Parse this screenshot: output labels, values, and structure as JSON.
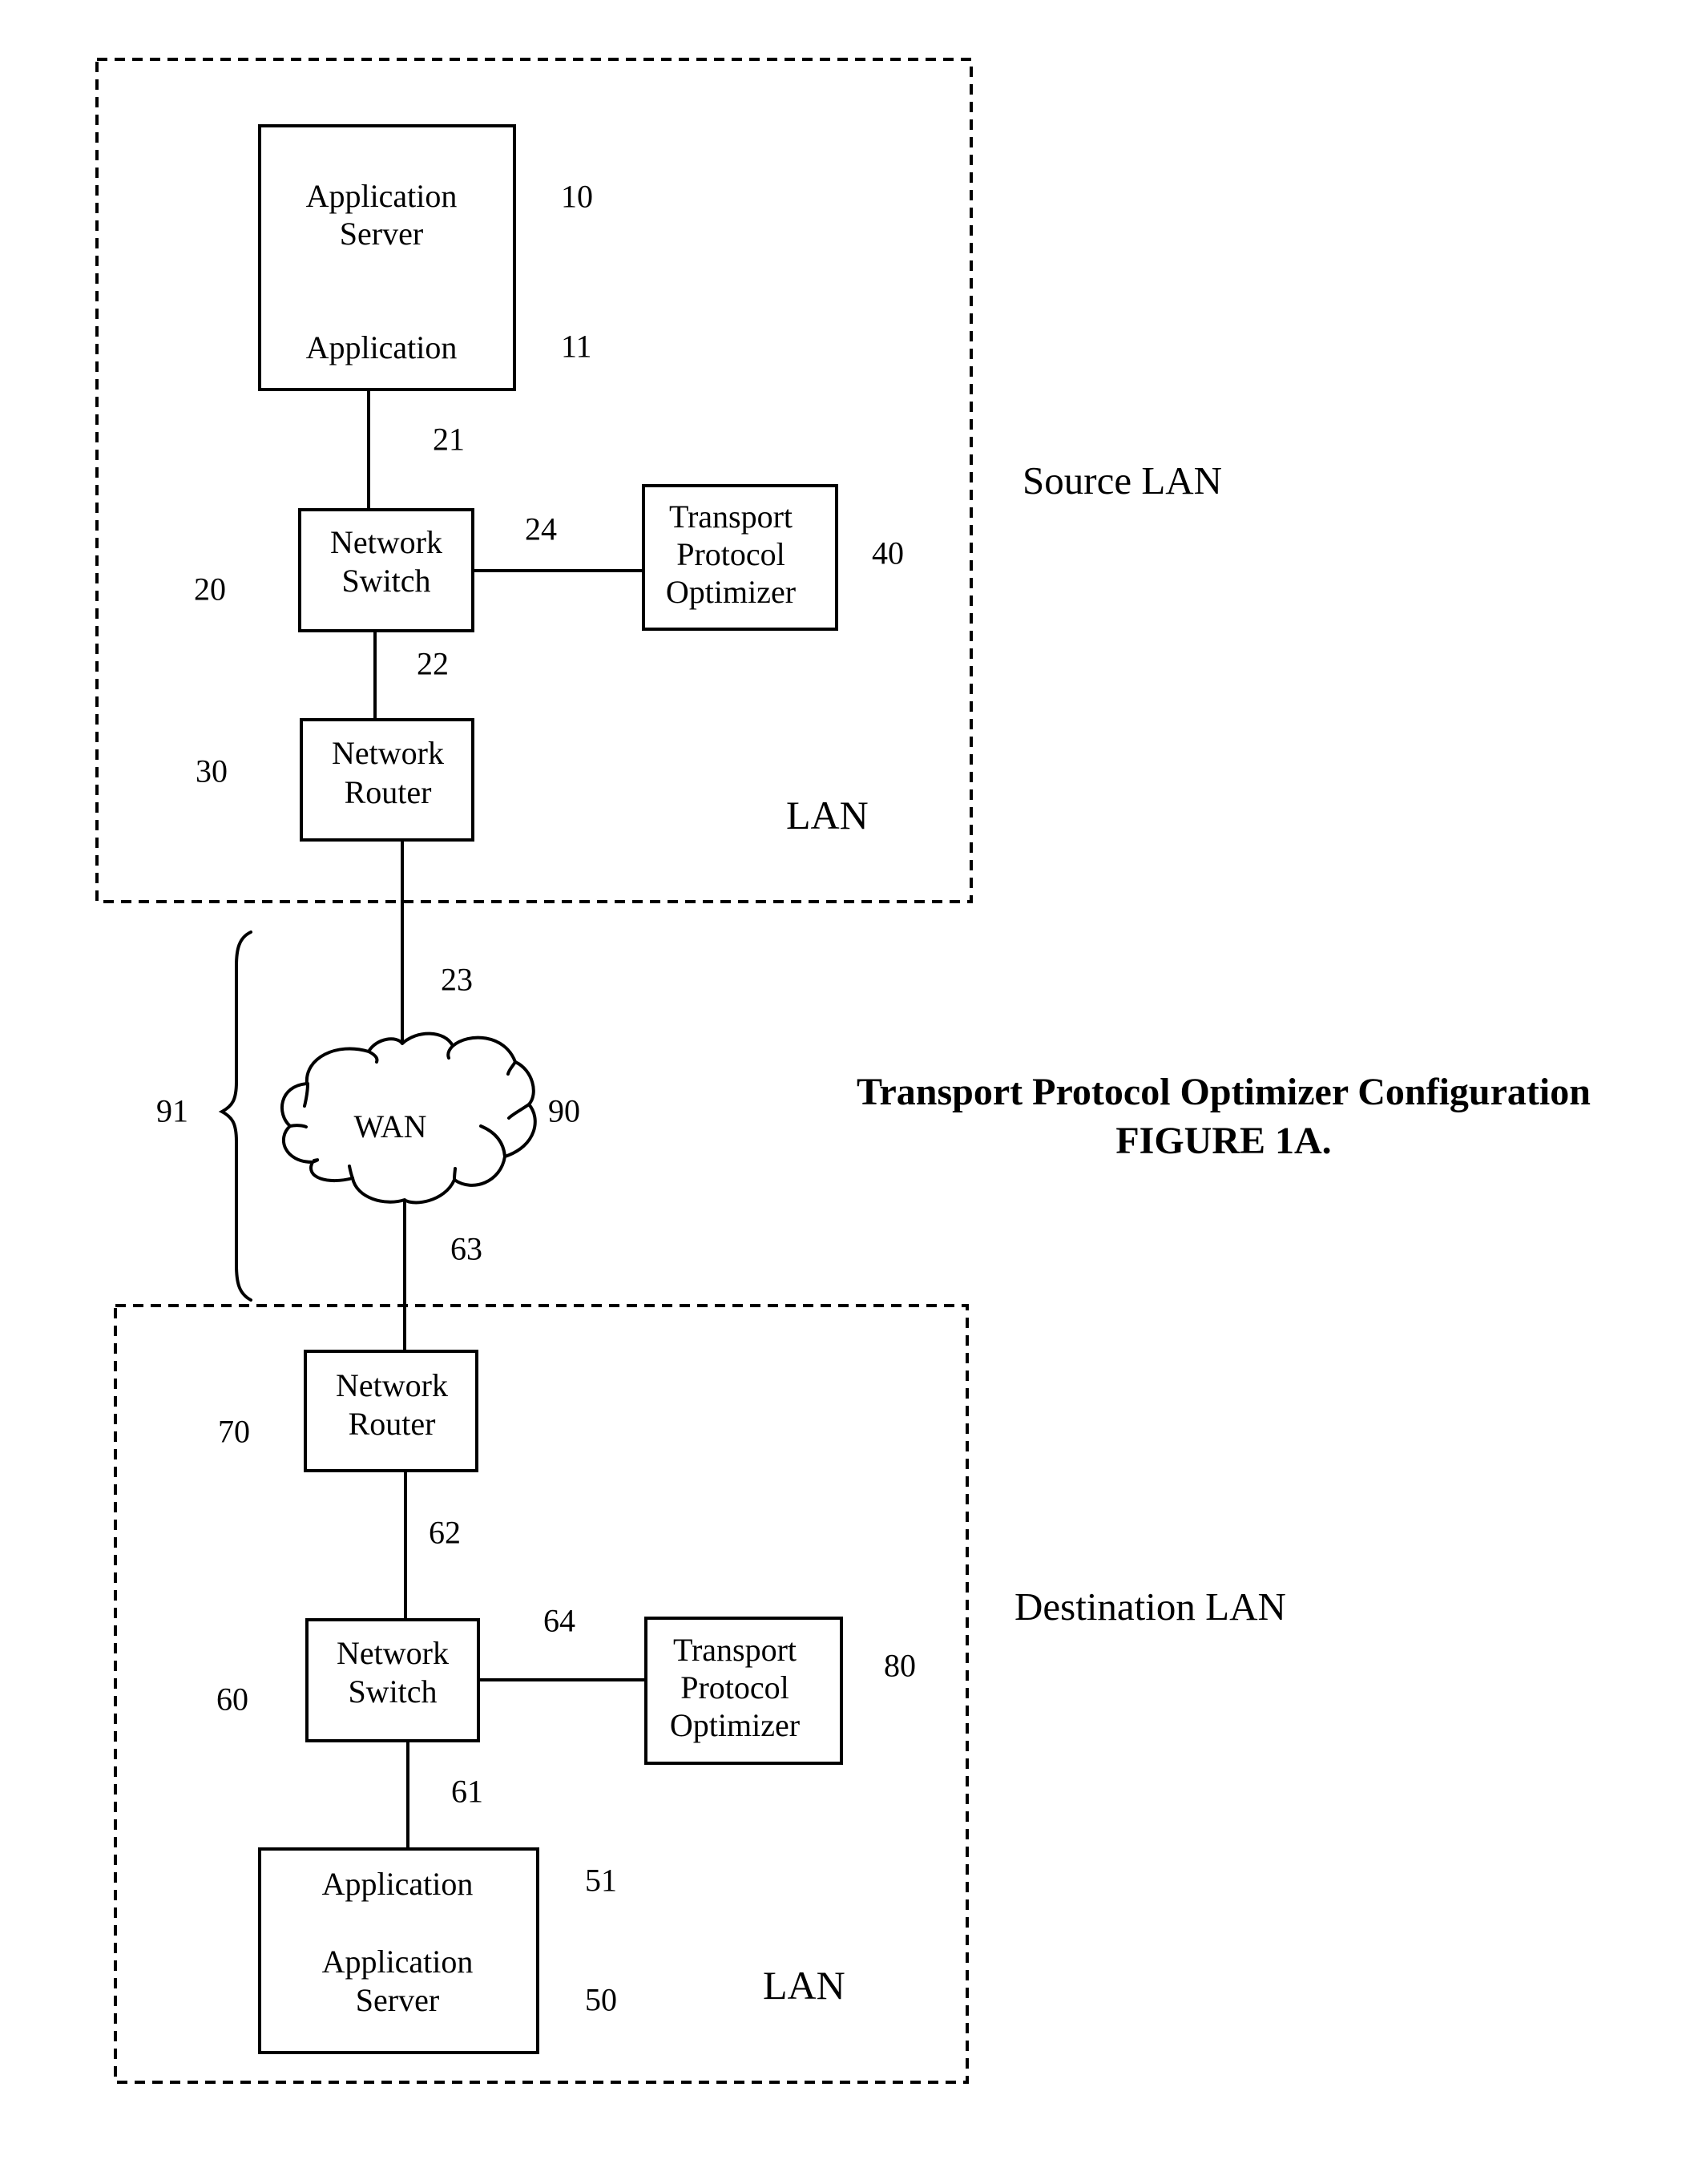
{
  "figure": {
    "caption_line1": "Transport Protocol Optimizer Configuration",
    "caption_line2": "FIGURE 1A."
  },
  "source_lan": {
    "side_label": "Source LAN",
    "inner_label": "LAN",
    "app_server": {
      "line1": "Application",
      "line2": "Server",
      "app_line": "Application",
      "ref_server": "10",
      "ref_app": "11"
    },
    "network_switch": {
      "line1": "Network",
      "line2": "Switch",
      "ref": "20"
    },
    "network_router": {
      "line1": "Network",
      "line2": "Router",
      "ref": "30"
    },
    "optimizer": {
      "line1": "Transport",
      "line2": "Protocol",
      "line3": "Optimizer",
      "ref": "40"
    },
    "links": {
      "server_switch": "21",
      "switch_router": "22",
      "switch_optimizer": "24"
    }
  },
  "wan": {
    "label": "WAN",
    "ref": "90",
    "span_ref": "91",
    "uplink_ref": "23",
    "downlink_ref": "63"
  },
  "destination_lan": {
    "side_label": "Destination LAN",
    "inner_label": "LAN",
    "network_router": {
      "line1": "Network",
      "line2": "Router",
      "ref": "70"
    },
    "network_switch": {
      "line1": "Network",
      "line2": "Switch",
      "ref": "60"
    },
    "optimizer": {
      "line1": "Transport",
      "line2": "Protocol",
      "line3": "Optimizer",
      "ref": "80"
    },
    "app_server": {
      "app_line": "Application",
      "line1": "Application",
      "line2": "Server",
      "ref_app": "51",
      "ref_server": "50"
    },
    "links": {
      "router_switch": "62",
      "switch_server": "61",
      "switch_optimizer": "64"
    }
  }
}
